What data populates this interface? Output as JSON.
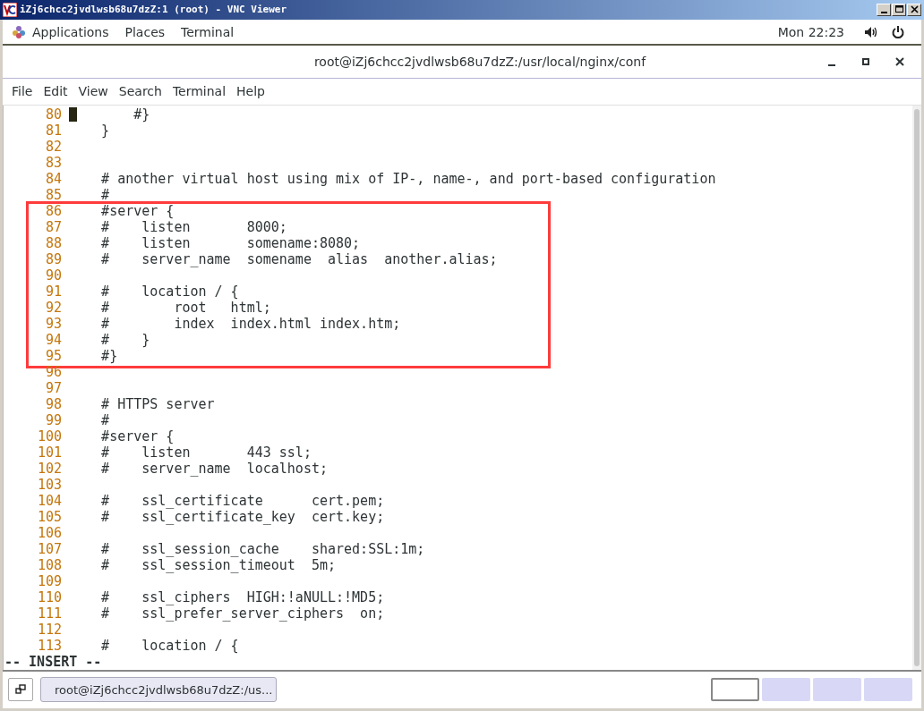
{
  "vnc_window": {
    "title": "iZj6chcc2jvdlwsb68u7dzZ:1 (root) - VNC Viewer"
  },
  "top_bar": {
    "menus": [
      "Applications",
      "Places",
      "Terminal"
    ],
    "clock": "Mon 22:23"
  },
  "terminal": {
    "title": "root@iZj6chcc2jvdlwsb68u7dzZ:/usr/local/nginx/conf",
    "menu": [
      "File",
      "Edit",
      "View",
      "Search",
      "Terminal",
      "Help"
    ],
    "line_groups": [
      {
        "highlighted": false,
        "lines": [
          {
            "number": "80",
            "text": "        #}",
            "cursor": true
          },
          {
            "number": "81",
            "text": "    }",
            "cursor": false
          },
          {
            "number": "82",
            "cursor": false
          },
          {
            "number": "83",
            "cursor": false
          },
          {
            "number": "84",
            "text": "    # another virtual host using mix of IP-, name-, and port-based configuration",
            "cursor": false
          },
          {
            "number": "85",
            "text": "    #",
            "cursor": false
          }
        ]
      },
      {
        "highlighted": true,
        "lines": [
          {
            "number": "86",
            "text": "    #server {",
            "cursor": false
          },
          {
            "number": "87",
            "text": "    #    listen       8000;",
            "cursor": false
          },
          {
            "number": "88",
            "text": "    #    listen       somename:8080;",
            "cursor": false
          },
          {
            "number": "89",
            "text": "    #    server_name  somename  alias  another.alias;",
            "cursor": false
          },
          {
            "number": "90",
            "cursor": false
          },
          {
            "number": "91",
            "text": "    #    location / {",
            "cursor": false
          },
          {
            "number": "92",
            "text": "    #        root   html;",
            "cursor": false
          },
          {
            "number": "93",
            "text": "    #        index  index.html index.htm;",
            "cursor": false
          },
          {
            "number": "94",
            "text": "    #    }",
            "cursor": false
          },
          {
            "number": "95",
            "text": "    #}",
            "cursor": false
          }
        ]
      },
      {
        "highlighted": false,
        "lines": [
          {
            "number": "96",
            "cursor": false
          },
          {
            "number": "97",
            "cursor": false
          },
          {
            "number": "98",
            "text": "    # HTTPS server",
            "cursor": false
          },
          {
            "number": "99",
            "text": "    #",
            "cursor": false
          },
          {
            "number": "100",
            "text": "    #server {",
            "cursor": false
          },
          {
            "number": "101",
            "text": "    #    listen       443 ssl;",
            "cursor": false
          },
          {
            "number": "102",
            "text": "    #    server_name  localhost;",
            "cursor": false
          },
          {
            "number": "103",
            "cursor": false
          },
          {
            "number": "104",
            "text": "    #    ssl_certificate      cert.pem;",
            "cursor": false
          },
          {
            "number": "105",
            "text": "    #    ssl_certificate_key  cert.key;",
            "cursor": false
          },
          {
            "number": "106",
            "cursor": false
          },
          {
            "number": "107",
            "text": "    #    ssl_session_cache    shared:SSL:1m;",
            "cursor": false
          },
          {
            "number": "108",
            "text": "    #    ssl_session_timeout  5m;",
            "cursor": false
          },
          {
            "number": "109",
            "cursor": false
          },
          {
            "number": "110",
            "text": "    #    ssl_ciphers  HIGH:!aNULL:!MD5;",
            "cursor": false
          },
          {
            "number": "111",
            "text": "    #    ssl_prefer_server_ciphers  on;",
            "cursor": false
          },
          {
            "number": "112",
            "cursor": false
          },
          {
            "number": "113",
            "text": "    #    location / {",
            "cursor": false
          }
        ]
      }
    ],
    "mode": "-- INSERT --"
  },
  "taskbar": {
    "window_button": "root@iZj6chcc2jvdlwsb68u7dzZ:/us...",
    "workspaces": [
      {
        "selected": true
      },
      {
        "selected": false
      },
      {
        "selected": false
      },
      {
        "selected": false
      }
    ]
  }
}
